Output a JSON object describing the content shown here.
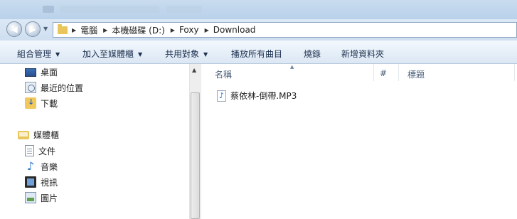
{
  "address": {
    "crumbs": [
      "電腦",
      "本機磁碟 (D:)",
      "Foxy",
      "Download"
    ]
  },
  "toolbar": {
    "organize": "組合管理",
    "add_to_library": "加入至媒體櫃",
    "share_with": "共用對象",
    "play_all": "播放所有曲目",
    "burn": "燒錄",
    "new_folder": "新增資料夾"
  },
  "navpane": {
    "favorites": [
      {
        "label": "桌面",
        "icon": "desktop-icon"
      },
      {
        "label": "最近的位置",
        "icon": "recent-places-icon"
      },
      {
        "label": "下載",
        "icon": "downloads-icon"
      }
    ],
    "libraries_label": "媒體櫃",
    "libraries": [
      {
        "label": "文件",
        "icon": "documents-icon"
      },
      {
        "label": "音樂",
        "icon": "music-icon"
      },
      {
        "label": "視訊",
        "icon": "video-icon"
      },
      {
        "label": "圖片",
        "icon": "pictures-icon"
      }
    ]
  },
  "content": {
    "columns": {
      "name": "名稱",
      "number": "#",
      "title": "標題"
    },
    "files": [
      {
        "name": "蔡依林-倒帶.MP3",
        "icon": "mp3-file-icon"
      }
    ]
  }
}
